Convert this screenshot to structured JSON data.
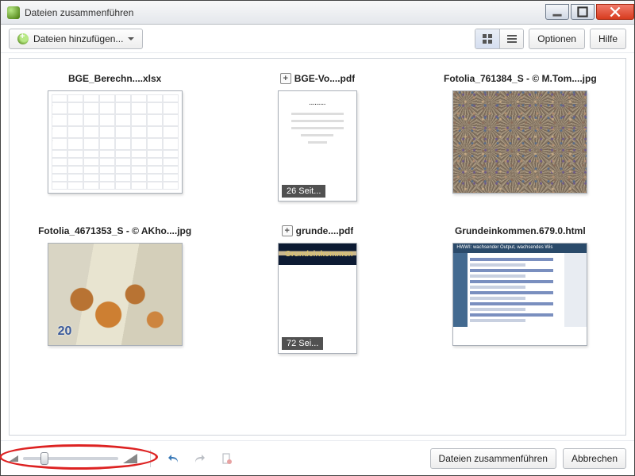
{
  "window": {
    "title": "Dateien zusammenführen"
  },
  "toolbar": {
    "add_files_label": "Dateien hinzufügen...",
    "options_label": "Optionen",
    "help_label": "Hilfe"
  },
  "files": [
    {
      "name": "BGE_Berechn....xlsx",
      "type": "xlsx",
      "pages": null
    },
    {
      "name": "BGE-Vo....pdf",
      "type": "pdf",
      "pages": "26 Seit..."
    },
    {
      "name": "Fotolia_761384_S - © M.Tom....jpg",
      "type": "jpg-crowd",
      "pages": null
    },
    {
      "name": "Fotolia_4671353_S - © AKho....jpg",
      "type": "jpg-coins",
      "pages": null
    },
    {
      "name": "grunde....pdf",
      "type": "pdf-dark",
      "pages": "72 Sei...",
      "thumb_title": "Grundeinkommen"
    },
    {
      "name": "Grundeinkommen.679.0.html",
      "type": "html",
      "pages": null,
      "thumb_bar": "HWWI: wachsender Output, wachsendes Wis"
    }
  ],
  "bottom": {
    "combine_label": "Dateien zusammenführen",
    "cancel_label": "Abbrechen"
  }
}
